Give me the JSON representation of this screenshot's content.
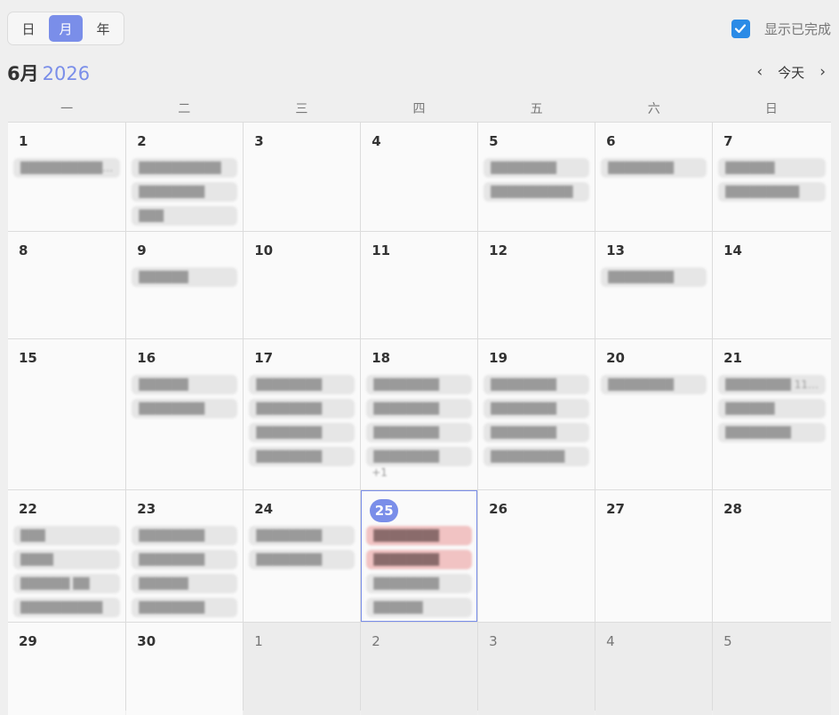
{
  "view_switch": {
    "day": "日",
    "month": "月",
    "year": "年"
  },
  "show_completed": {
    "label": "显示已完成"
  },
  "header": {
    "month": "6月",
    "year": "2026",
    "today": "今天",
    "prev": "‹",
    "next": "›"
  },
  "weekdays": [
    "一",
    "二",
    "三",
    "四",
    "五",
    "六",
    "日"
  ],
  "days": {
    "d1": "1",
    "d2": "2",
    "d3": "3",
    "d4": "4",
    "d5": "5",
    "d6": "6",
    "d7": "7",
    "d8": "8",
    "d9": "9",
    "d10": "10",
    "d11": "11",
    "d12": "12",
    "d13": "13",
    "d14": "14",
    "d15": "15",
    "d16": "16",
    "d17": "17",
    "d18": "18",
    "d19": "19",
    "d20": "20",
    "d21": "21",
    "d22": "22",
    "d23": "23",
    "d24": "24",
    "d25": "25",
    "d26": "26",
    "d27": "27",
    "d28": "28",
    "d29": "29",
    "d30": "30",
    "n1": "1",
    "n2": "2",
    "n3": "3",
    "n4": "4",
    "n5": "5"
  },
  "events": {
    "d1": [
      "██████████…"
    ],
    "d2": [
      "██████████",
      "████████",
      "███"
    ],
    "d5": [
      "████████",
      "██████████"
    ],
    "d6": [
      "████████"
    ],
    "d7": [
      "██████",
      "█████████"
    ],
    "d9": [
      "██████"
    ],
    "d13": [
      "████████"
    ],
    "d16": [
      "██████",
      "████████"
    ],
    "d17": [
      "████████",
      "████████",
      "████████",
      "████████"
    ],
    "d18": [
      "████████",
      "████████",
      "████████",
      "████████"
    ],
    "d19": [
      "████████",
      "████████",
      "████████",
      "█████████"
    ],
    "d20": [
      "████████"
    ],
    "d21": [
      "████████ 11…",
      "██████",
      "████████"
    ],
    "d22": [
      "███",
      "████",
      "██████ ██",
      "██████████"
    ],
    "d23": [
      "████████",
      "████████",
      "██████",
      "████████"
    ],
    "d24": [
      "████████",
      "████████"
    ],
    "d25": [
      "████████",
      "████████",
      "████████",
      "██████"
    ]
  },
  "more": {
    "d18": "+1"
  }
}
